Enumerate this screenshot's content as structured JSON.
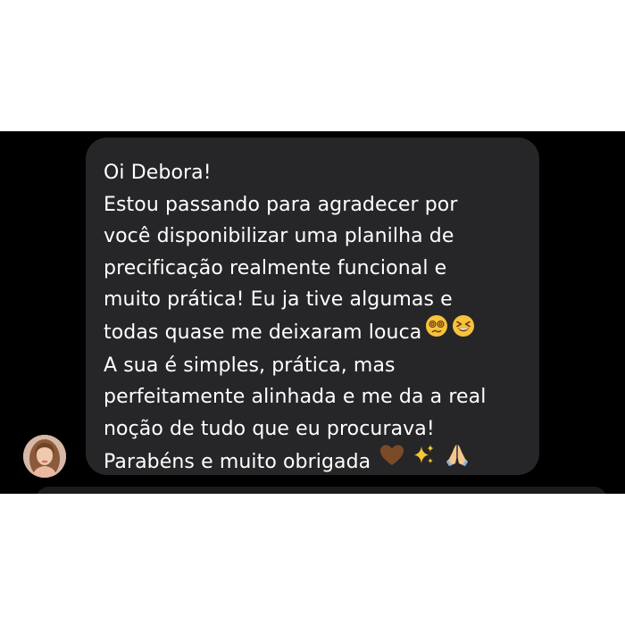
{
  "message": {
    "lines": [
      "Oi Debora!",
      "Estou passando para agradecer por",
      "você disponibilizar uma planilha de",
      "precificação realmente funcional e",
      "muito prática! Eu ja tive algumas e",
      "todas quase me deixaram louca",
      "A sua é simples, prática, mas",
      "perfeitamente alinhada e me da a real",
      "noção de tudo que eu procurava!",
      "Parabéns e muito obrigada"
    ],
    "line6_emojis": [
      "dizzy-face-emoji",
      "grinning-squinting-face-emoji"
    ],
    "line10_emojis": [
      "brown-heart-emoji",
      "sparkles-emoji",
      "folded-hands-emoji"
    ]
  },
  "colors": {
    "background": "#ffffff",
    "chat_background": "#000000",
    "bubble": "#262628",
    "text": "#ffffff"
  },
  "sender": {
    "avatar": "sender-avatar"
  }
}
